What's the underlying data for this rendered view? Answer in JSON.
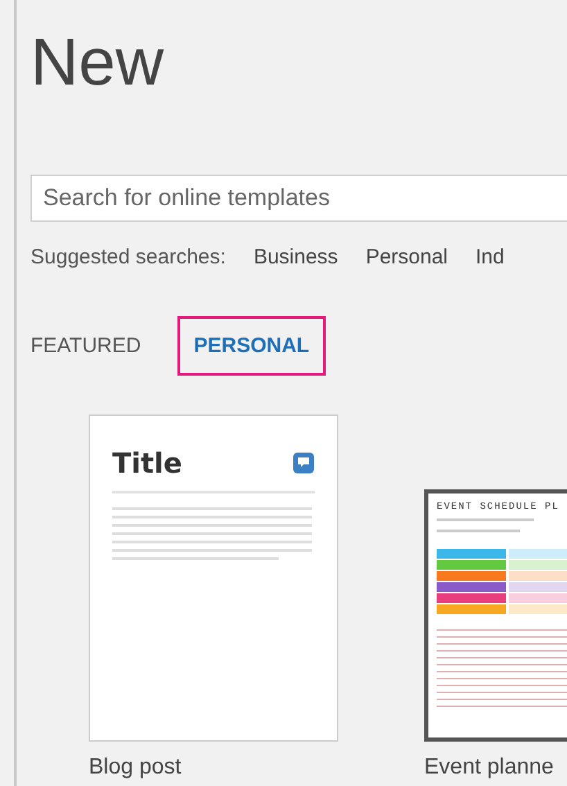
{
  "heading": "New",
  "search": {
    "placeholder": "Search for online templates"
  },
  "suggested": {
    "label": "Suggested searches:",
    "links": [
      "Business",
      "Personal",
      "Ind"
    ]
  },
  "tabs": [
    {
      "label": "FEATURED",
      "selected": false
    },
    {
      "label": "PERSONAL",
      "selected": true
    }
  ],
  "templates": [
    {
      "kind": "blog",
      "name": "Blog post",
      "preview_title": "Title"
    },
    {
      "kind": "schedule",
      "name": "Event planne",
      "preview_title": "EVENT SCHEDULE PL"
    }
  ]
}
